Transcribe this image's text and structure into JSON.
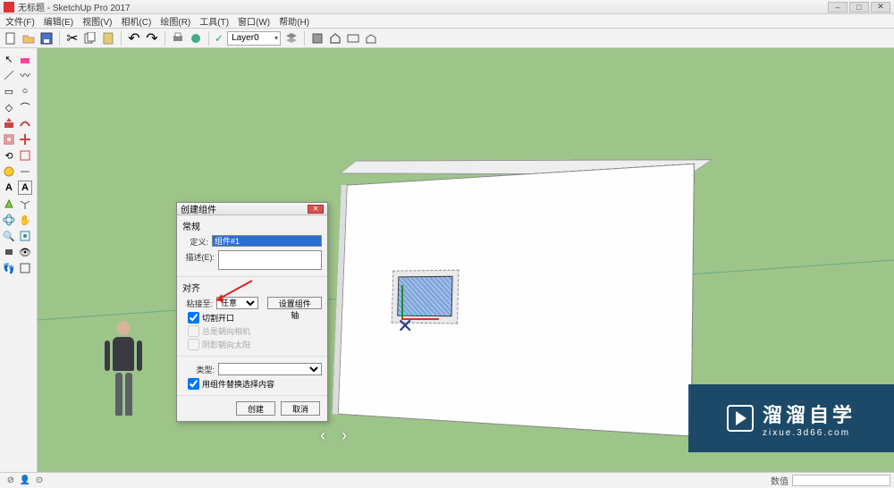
{
  "title": "无标题 - SketchUp Pro 2017",
  "menu": {
    "file": "文件(F)",
    "edit": "编辑(E)",
    "view": "视图(V)",
    "camera": "相机(C)",
    "draw": "绘图(R)",
    "tools": "工具(T)",
    "window": "窗口(W)",
    "help": "帮助(H)"
  },
  "toolbar": {
    "layer": "Layer0"
  },
  "dialog": {
    "title": "创建组件",
    "section_general": "常规",
    "label_definition": "定义:",
    "definition_value": "组件#1",
    "label_description": "描述(E):",
    "section_align": "对齐",
    "label_glue": "粘接至:",
    "glue_value": "任意",
    "btn_set_axes": "设置组件轴",
    "chk_cut": "切割开口",
    "chk_face": "总是朝向相机",
    "chk_shadow": "阴影朝向太阳",
    "label_type": "类型:",
    "chk_replace": "用组件替换选择内容",
    "btn_create": "创建",
    "btn_cancel": "取消"
  },
  "statusbar": {
    "value_label": "数值"
  },
  "watermark": {
    "big": "溜溜自学",
    "small": "zixue.3d66.com"
  }
}
